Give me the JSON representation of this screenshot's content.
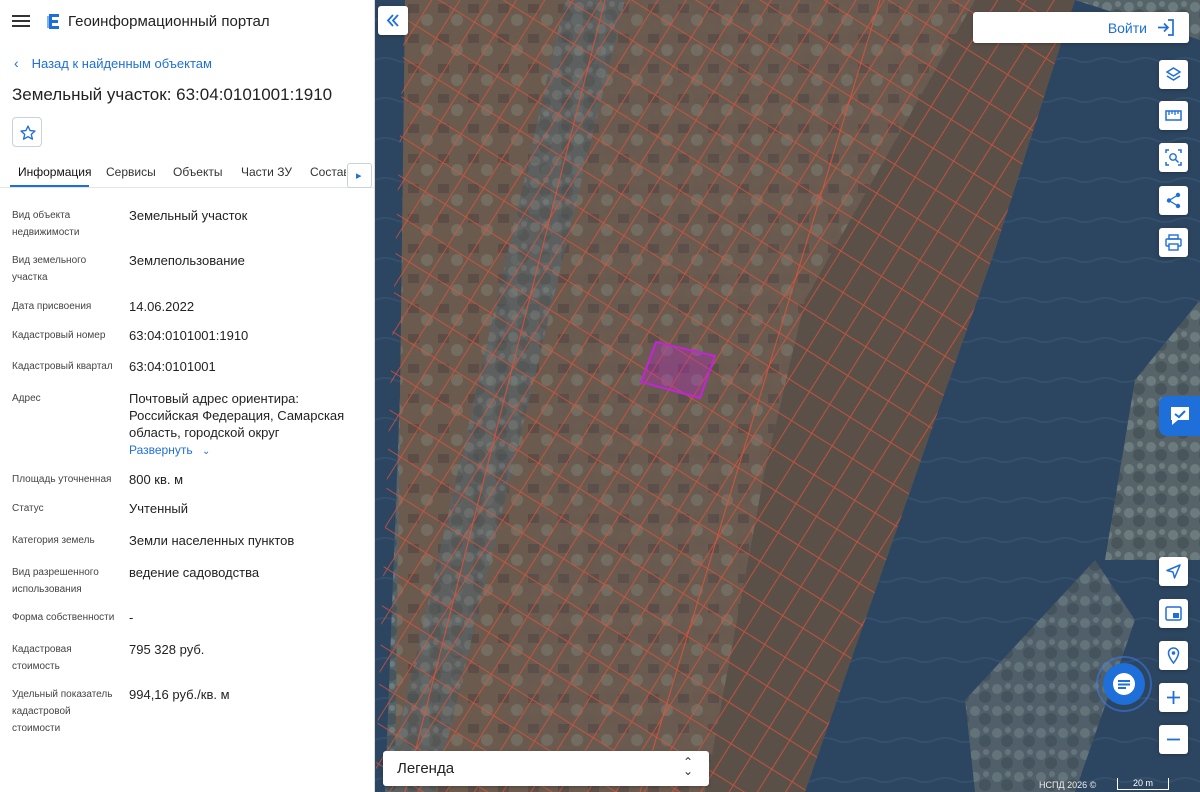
{
  "header": {
    "app_title": "Геоинформационный портал",
    "menu_icon": "hamburger-icon",
    "logo_icon": "portal-logo-icon"
  },
  "back_link": {
    "label": "Назад к найденным объектам"
  },
  "object": {
    "title": "Земельный участок: 63:04:0101001:1910"
  },
  "tabs": [
    {
      "label": "Информация",
      "active": true
    },
    {
      "label": "Сервисы"
    },
    {
      "label": "Объекты"
    },
    {
      "label": "Части ЗУ"
    },
    {
      "label": "Состав"
    }
  ],
  "info": {
    "rows": [
      {
        "label": "Вид объекта недвижимости",
        "value": "Земельный участок"
      },
      {
        "label": "Вид земельного участка",
        "value": "Землепользование"
      },
      {
        "label": "Дата присвоения",
        "value": "14.06.2022"
      },
      {
        "label": "Кадастровый номер",
        "value": "63:04:0101001:1910"
      },
      {
        "label": "Кадастровый квартал",
        "value": "63:04:0101001"
      },
      {
        "label": "Адрес",
        "value": "Почтовый адрес ориентира: Российская Федерация, Самарская область, городской округ"
      },
      {
        "label": "Площадь уточненная",
        "value": "800 кв. м"
      },
      {
        "label": "Статус",
        "value": "Учтенный"
      },
      {
        "label": "Категория земель",
        "value": "Земли населенных пунктов"
      },
      {
        "label": "Вид разрешенного использования",
        "value": "ведение садоводства"
      },
      {
        "label": "Форма собственности",
        "value": "-"
      },
      {
        "label": "Кадастровая стоимость",
        "value": "795 328 руб."
      },
      {
        "label": "Удельный показатель кадастровой стоимости",
        "value": "994,16 руб./кв. м"
      }
    ],
    "expand_label": "Развернуть"
  },
  "map": {
    "login_label": "Войти",
    "legend_label": "Легенда",
    "attribution": "НСПД 2026 ©",
    "scale_label": "20 m",
    "accent_color": "#1e6fd9",
    "parcel_highlight_color": "#c026d3",
    "parcel_line_color": "#e0533a",
    "tools": [
      "layers-icon",
      "ruler-icon",
      "area-select-icon",
      "share-icon",
      "print-icon"
    ],
    "nav": [
      "locate-icon",
      "minimap-icon",
      "geolocation-icon",
      "zoom-in-icon",
      "zoom-out-icon"
    ]
  }
}
